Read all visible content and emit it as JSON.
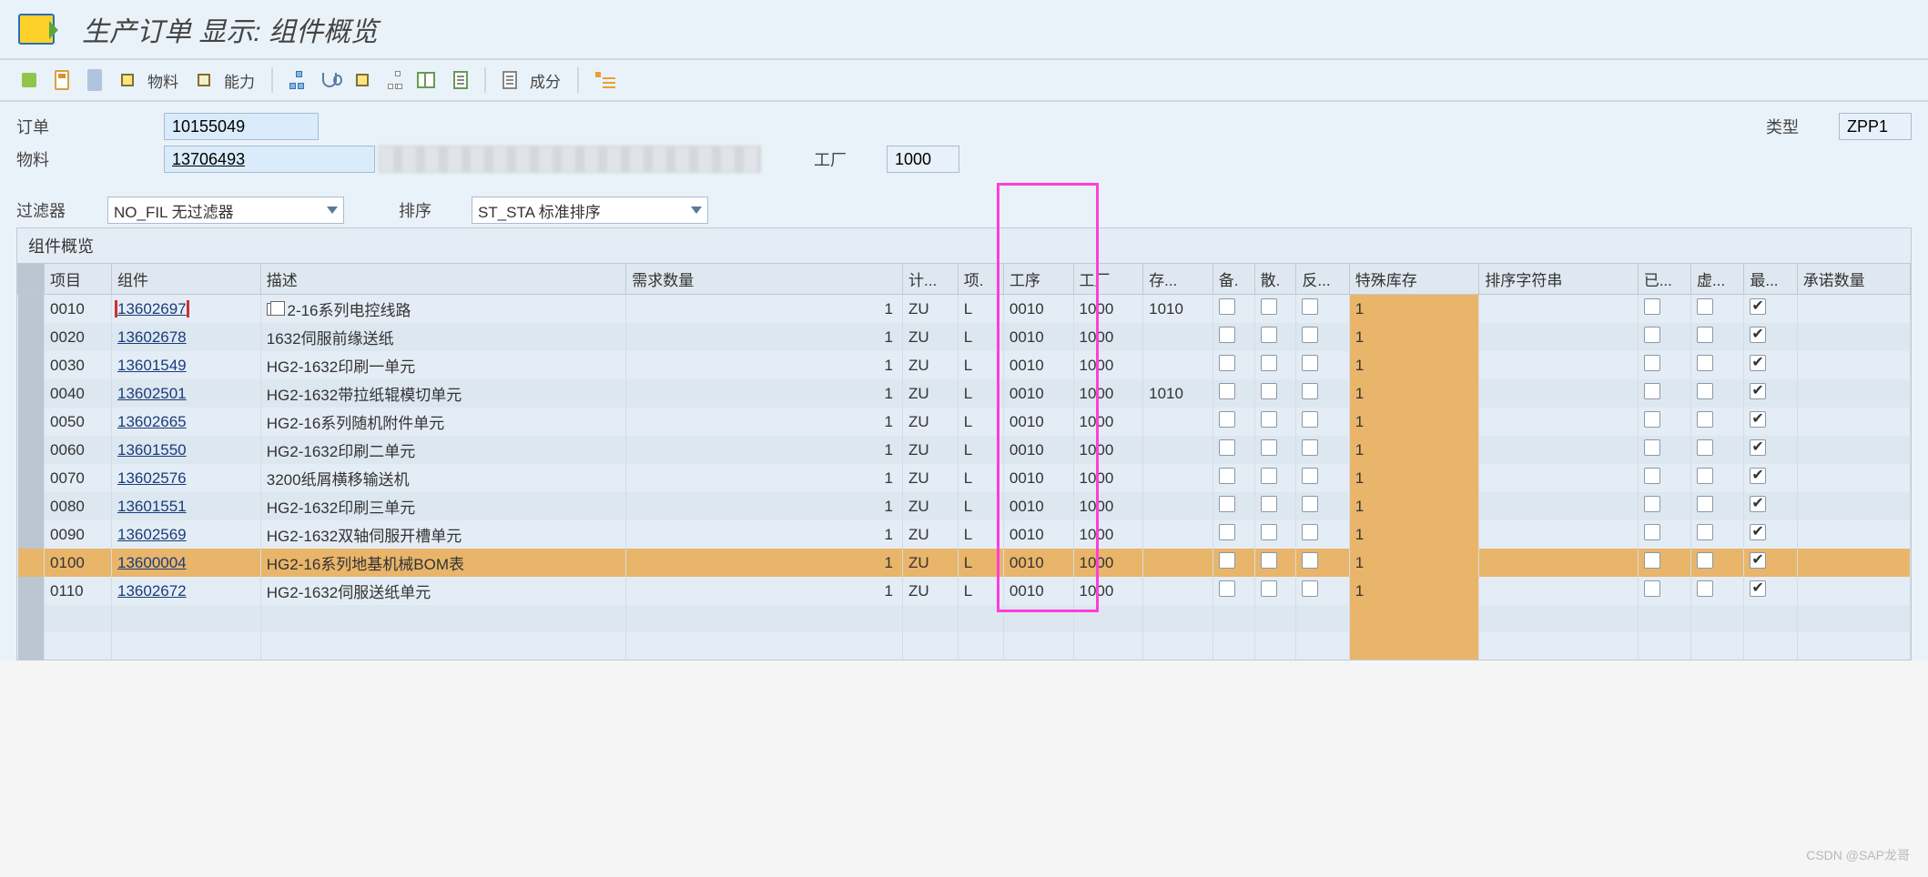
{
  "title": "生产订单 显示: 组件概览",
  "toolbar": {
    "material_label": "物料",
    "capacity_label": "能力",
    "component_label": "成分"
  },
  "header": {
    "order_label": "订单",
    "order_value": "10155049",
    "material_label": "物料",
    "material_value": "13706493",
    "type_label": "类型",
    "type_value": "ZPP1",
    "plant_label": "工厂",
    "plant_value": "1000"
  },
  "filter": {
    "filter_label": "过滤器",
    "filter_value": "NO_FIL 无过滤器",
    "sort_label": "排序",
    "sort_value": "ST_STA 标准排序"
  },
  "panel_title": "组件概览",
  "columns": {
    "item": "项目",
    "component": "组件",
    "description": "描述",
    "qty": "需求数量",
    "unit": "计...",
    "itemcat": "项.",
    "op": "工序",
    "plant": "工厂",
    "sloc": "存...",
    "bk": "备.",
    "sd": "散.",
    "fj": "反...",
    "spstock": "特殊库存",
    "sortstr": "排序字符串",
    "yj": "已...",
    "xn": "虚...",
    "zd": "最...",
    "commit": "承诺数量"
  },
  "rows": [
    {
      "item": "0010",
      "comp": "13602697",
      "desc": "2-16系列电控线路",
      "qty": "1",
      "unit": "ZU",
      "ic": "L",
      "op": "0010",
      "plant": "1000",
      "sloc": "1010",
      "sp": "1",
      "zd": true,
      "first": true
    },
    {
      "item": "0020",
      "comp": "13602678",
      "desc": "1632伺服前缘送纸",
      "qty": "1",
      "unit": "ZU",
      "ic": "L",
      "op": "0010",
      "plant": "1000",
      "sloc": "",
      "sp": "1",
      "zd": true
    },
    {
      "item": "0030",
      "comp": "13601549",
      "desc": "HG2-1632印刷一单元",
      "qty": "1",
      "unit": "ZU",
      "ic": "L",
      "op": "0010",
      "plant": "1000",
      "sloc": "",
      "sp": "1",
      "zd": true
    },
    {
      "item": "0040",
      "comp": "13602501",
      "desc": "HG2-1632带拉纸辊模切单元",
      "qty": "1",
      "unit": "ZU",
      "ic": "L",
      "op": "0010",
      "plant": "1000",
      "sloc": "1010",
      "sp": "1",
      "zd": true
    },
    {
      "item": "0050",
      "comp": "13602665",
      "desc": "HG2-16系列随机附件单元",
      "qty": "1",
      "unit": "ZU",
      "ic": "L",
      "op": "0010",
      "plant": "1000",
      "sloc": "",
      "sp": "1",
      "zd": true
    },
    {
      "item": "0060",
      "comp": "13601550",
      "desc": "HG2-1632印刷二单元",
      "qty": "1",
      "unit": "ZU",
      "ic": "L",
      "op": "0010",
      "plant": "1000",
      "sloc": "",
      "sp": "1",
      "zd": true
    },
    {
      "item": "0070",
      "comp": "13602576",
      "desc": "3200纸屑横移输送机",
      "qty": "1",
      "unit": "ZU",
      "ic": "L",
      "op": "0010",
      "plant": "1000",
      "sloc": "",
      "sp": "1",
      "zd": true
    },
    {
      "item": "0080",
      "comp": "13601551",
      "desc": "HG2-1632印刷三单元",
      "qty": "1",
      "unit": "ZU",
      "ic": "L",
      "op": "0010",
      "plant": "1000",
      "sloc": "",
      "sp": "1",
      "zd": true
    },
    {
      "item": "0090",
      "comp": "13602569",
      "desc": "HG2-1632双轴伺服开槽单元",
      "qty": "1",
      "unit": "ZU",
      "ic": "L",
      "op": "0010",
      "plant": "1000",
      "sloc": "",
      "sp": "1",
      "zd": true
    },
    {
      "item": "0100",
      "comp": "13600004",
      "desc": "HG2-16系列地基机械BOM表",
      "qty": "1",
      "unit": "ZU",
      "ic": "L",
      "op": "0010",
      "plant": "1000",
      "sloc": "",
      "sp": "1",
      "zd": true,
      "hl": true
    },
    {
      "item": "0110",
      "comp": "13602672",
      "desc": "HG2-1632伺服送纸单元",
      "qty": "1",
      "unit": "ZU",
      "ic": "L",
      "op": "0010",
      "plant": "1000",
      "sloc": "",
      "sp": "1",
      "zd": true
    }
  ],
  "watermark": "CSDN @SAP龙哥"
}
